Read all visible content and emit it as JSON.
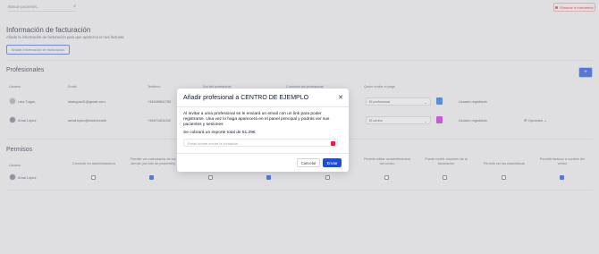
{
  "topbar": {
    "search_placeholder": "Buscar pacientes...",
    "danger_label": "Eliminar a Inteviefest"
  },
  "billing": {
    "title": "Información de facturación",
    "subtitle": "Añade la información de facturación para que aparezca en tus facturas",
    "button": "Añadir información de facturación"
  },
  "professionals": {
    "title": "Profesionales",
    "headers": [
      "Usuario",
      "Email",
      "Teléfono",
      "Rol del profesional",
      "Comisión del profesional",
      "Quien recibe el pago"
    ],
    "rows": [
      {
        "initials": "LT",
        "name": "Laia Tugas",
        "email": "laiatugas01@gmail.com",
        "phone": "+34649661755",
        "payee": "El profesional",
        "color": "#1d6fd8",
        "status": "Usuario registrado"
      },
      {
        "initials": "AL",
        "name": "Amai López",
        "email": "amairlopez@kmdchealth",
        "phone": "+34671624242",
        "payee": "El centro",
        "color": "#c026d3",
        "status": "Usuario registrado",
        "options": "Opciones"
      }
    ]
  },
  "permisos": {
    "title": "Permisos",
    "headers": [
      "Usuario",
      "Convertir en administrador/a",
      "Permitir ver calendarios de los demás (sin info de pacientes)",
      "",
      "",
      "",
      "Permitir editar consentimientos del centro",
      "Puede recibir resumen de la facturación",
      "Permitir ver las estadísticas",
      "Permitir facturar a nombre del centro"
    ],
    "user": "Amai López",
    "checks": [
      false,
      true,
      false,
      true,
      false,
      false,
      false,
      false,
      true
    ]
  },
  "modal": {
    "title": "Añadir profesional a CENTRO DE EJEMPLO",
    "body": "Al invitar a un/a profesional se le enviará un email con un link para poder registrarse. Una vez lo haga aparecerá en el panel principal y podrás ver sus pacientes y sesiones",
    "note": "Se cobrará un importe total de 51.29€",
    "email_placeholder": "Email donde enviar la invitación",
    "cancel": "Cancelar",
    "send": "Enviar"
  }
}
